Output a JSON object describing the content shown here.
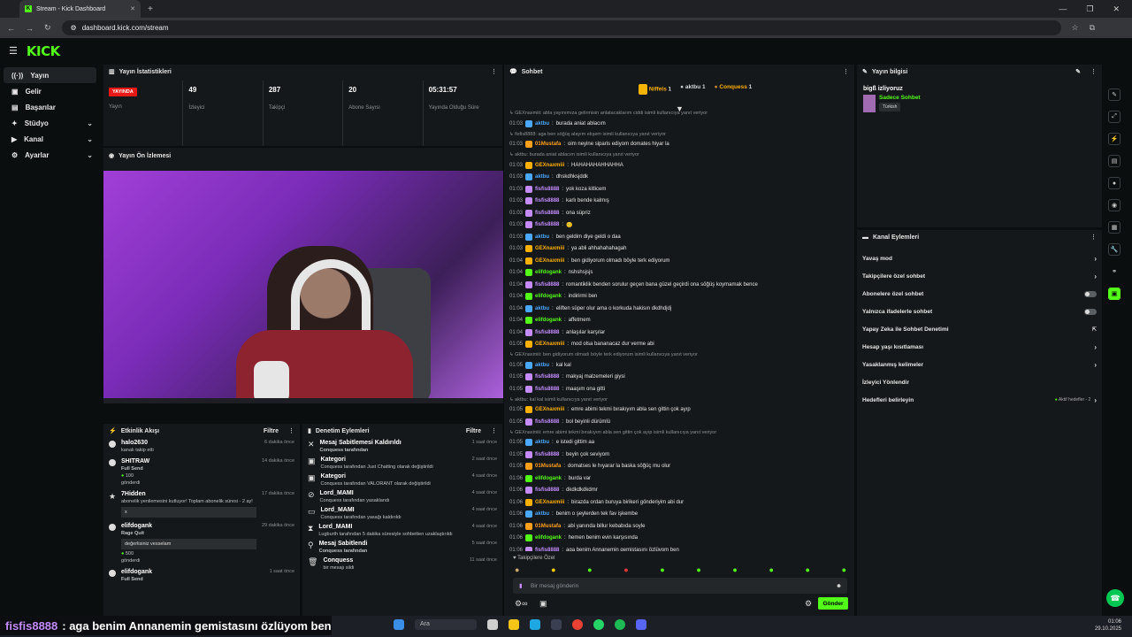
{
  "browser": {
    "tab_title": "Stream - Kick Dashboard",
    "url": "dashboard.kick.com/stream"
  },
  "sidebar": {
    "items": [
      {
        "label": "Yayın"
      },
      {
        "label": "Gelir"
      },
      {
        "label": "Başarılar"
      },
      {
        "label": "Stüdyo"
      },
      {
        "label": "Kanal"
      },
      {
        "label": "Ayarlar"
      }
    ]
  },
  "stats": {
    "title": "Yayın İstatistikleri",
    "live_badge": "YAYINDA",
    "live_label": "Yayın",
    "viewers": "49",
    "viewers_label": "İzleyici",
    "followers": "287",
    "followers_label": "Takipçi",
    "subs": "20",
    "subs_label": "Abone Sayısı",
    "duration": "05:31:57",
    "duration_label": "Yayında Olduğu Süre"
  },
  "preview": {
    "title": "Yayın Ön İzlemesi"
  },
  "activity": {
    "title": "Etkinlik Akışı",
    "filter": "Filtre",
    "events": [
      {
        "name": "halo2630",
        "sub": "kanalı takip etti",
        "time": "6 dakika önce"
      },
      {
        "name": "SHITRAW",
        "sub": "Full Send",
        "extra": "100",
        "extra2": "gönderdi",
        "time": "14 dakika önce"
      },
      {
        "name": "7Hidden",
        "sub": "abonelik yenilemesini kutluyor! Toplam abonelik süresi - 2 ay!",
        "box": "x",
        "time": "17 dakika önce"
      },
      {
        "name": "elifdogank",
        "sub": "Rage Quit",
        "box": "değerlisiniz vesselam",
        "extra": "500",
        "extra2": "gönderdi",
        "time": "29 dakika önce"
      },
      {
        "name": "elifdogank",
        "sub": "Full Send",
        "time": "1 saat önce"
      }
    ]
  },
  "moderation": {
    "title": "Denetim Eylemleri",
    "filter": "Filtre",
    "events": [
      {
        "name": "Mesaj Sabitlemesi Kaldırıldı",
        "sub": "Conquess tarafından",
        "time": "1 saat önce"
      },
      {
        "name": "Kategori",
        "sub": "Conquess tarafından Just Chatting olarak değiştirildi",
        "time": "2 saat önce"
      },
      {
        "name": "Kategori",
        "sub": "Conquess tarafından VALORANT olarak değiştirildi",
        "time": "4 saat önce"
      },
      {
        "name": "Lord_MAMI",
        "sub": "Conquess tarafından yasaklandı",
        "time": "4 saat önce"
      },
      {
        "name": "Lord_MAMI",
        "sub": "Conquess tarafından yasağı kaldırıldı",
        "time": "4 saat önce"
      },
      {
        "name": "Lord_MAMI",
        "sub": "Lugburth tarafından 5 dakika süresiyle sohbetten uzaklaştırıldı",
        "time": "4 saat önce"
      },
      {
        "name": "Mesaj Sabitlendi",
        "sub": "Conquess tarafından",
        "time": "5 saat önce"
      },
      {
        "name": "Conquess",
        "sub": "bir mesajı sildi",
        "time": "11 saat önce"
      }
    ]
  },
  "chat": {
    "title": "Sohbet",
    "top": [
      {
        "name": "Niffels",
        "count": "1"
      },
      {
        "name": "aktbu",
        "count": "1"
      },
      {
        "name": "Conquess",
        "count": "1"
      }
    ],
    "messages": [
      {
        "sys": true,
        "text": "GEXnaxmiii: abla yayınımıza gelirmisin anlatacaklarım ciddi isimli kullanıcıya yanıt veriyor"
      },
      {
        "time": "01:03",
        "user": "aktbu",
        "color": "#4aa8ff",
        "text": "burada aniat ablacım"
      },
      {
        "sys": true,
        "text": "fisfis8888: aga ben söğüş alayım ekşem isimli kullanıcıya yanıt veriyor"
      },
      {
        "time": "01:03",
        "user": "01Mustafa",
        "color": "#ff9f1a",
        "text": "oim neyine siparis ediyom domates hiyar la"
      },
      {
        "sys": true,
        "text": "aktbu: burada aniat ablacım isimli kullanıcıya yanıt veriyor"
      },
      {
        "time": "01:03",
        "user": "GEXnaxmiii",
        "color": "#ffb000",
        "text": "HAHAHAHAHHAHHA"
      },
      {
        "time": "01:03",
        "user": "aktbu",
        "color": "#4aa8ff",
        "text": "dhskdhksjddk"
      },
      {
        "time": "01:03",
        "user": "fisfis8888",
        "color": "#c48cff",
        "text": "yok koza kitlicem"
      },
      {
        "time": "01:03",
        "user": "fisfis8888",
        "color": "#c48cff",
        "text": "karlı bende kalmış"
      },
      {
        "time": "01:03",
        "user": "fisfis8888",
        "color": "#c48cff",
        "text": "ona süpriz"
      },
      {
        "time": "01:03",
        "user": "fisfis8888",
        "color": "#c48cff",
        "text": "🙂"
      },
      {
        "time": "01:03",
        "user": "aktbu",
        "color": "#4aa8ff",
        "text": "ben geldim diye geldi o daa"
      },
      {
        "time": "01:03",
        "user": "GEXnaxmiii",
        "color": "#ffb000",
        "text": "ya abli ahhahahahagah"
      },
      {
        "time": "01:04",
        "user": "GEXnaxmiii",
        "color": "#ffb000",
        "text": "ben gidiyorum olmadı böyle terk ediyorum"
      },
      {
        "time": "01:04",
        "user": "elifdogank",
        "color": "#53fc18",
        "text": "nshshsjsjs"
      },
      {
        "time": "01:04",
        "user": "fisfis8888",
        "color": "#c48cff",
        "text": "romantiklik benden sorulur geçen bana güzel geçirdi ona söğüş koymamak bence"
      },
      {
        "time": "01:04",
        "user": "elifdogank",
        "color": "#53fc18",
        "text": "indirirmi ben"
      },
      {
        "time": "01:04",
        "user": "aktbu",
        "color": "#4aa8ff",
        "text": "eliften süper olur ama o korkuda hakisın dkdhdjdj"
      },
      {
        "time": "01:04",
        "user": "elifdogank",
        "color": "#53fc18",
        "text": "affetmem"
      },
      {
        "time": "01:04",
        "user": "fisfis8888",
        "color": "#c48cff",
        "text": "anlaşılar karşılar"
      },
      {
        "time": "01:05",
        "user": "GEXnaxmiii",
        "color": "#ffb000",
        "text": "mod olsa bananacaz dur verme abi"
      },
      {
        "sys": true,
        "text": "GEXnaxmiii: ben gidiyorum olmadı böyle terk ediyorum isimli kullanıcıya yanıt veriyor"
      },
      {
        "time": "01:05",
        "user": "aktbu",
        "color": "#4aa8ff",
        "text": "kal kal"
      },
      {
        "time": "01:05",
        "user": "fisfis8888",
        "color": "#c48cff",
        "text": "makyaj malzemeleri giysi"
      },
      {
        "time": "01:05",
        "user": "fisfis8888",
        "color": "#c48cff",
        "text": "maaşım ona gitti"
      },
      {
        "sys": true,
        "text": "aktbu: kal kal isimli kullanıcıya yanıt veriyor"
      },
      {
        "time": "01:05",
        "user": "GEXnaxmiii",
        "color": "#ffb000",
        "text": "emre abimi tekmi bırakıyım abla sen gittin çok ayıp"
      },
      {
        "time": "01:05",
        "user": "fisfis8888",
        "color": "#c48cff",
        "text": "bol beyinli dürümlü"
      },
      {
        "sys": true,
        "text": "GEXnaxmiii: emre abimi tekmi bırakıyım abla sen gittin çok ayıp isimli kullanıcıya yanıt veriyor"
      },
      {
        "time": "01:05",
        "user": "aktbu",
        "color": "#4aa8ff",
        "text": "e istedi gittim aa"
      },
      {
        "time": "01:05",
        "user": "fisfis8888",
        "color": "#c48cff",
        "text": "beyin çok seviyom"
      },
      {
        "time": "01:05",
        "user": "01Mustafa",
        "color": "#ff9f1a",
        "text": "domatses le hıyarar la baska söğüç mu olur"
      },
      {
        "time": "01:06",
        "user": "elifdogank",
        "color": "#53fc18",
        "text": "burda var"
      },
      {
        "time": "01:06",
        "user": "fisfis8888",
        "color": "#c48cff",
        "text": "dkdkdkdkdmr"
      },
      {
        "time": "01:06",
        "user": "GEXnaxmiii",
        "color": "#ffb000",
        "text": "birazda ordan buruya birikeri gönderiyim abi dur"
      },
      {
        "time": "01:06",
        "user": "aktbu",
        "color": "#4aa8ff",
        "text": "benim o şeylerden tek fav işkembe"
      },
      {
        "time": "01:06",
        "user": "01Mustafa",
        "color": "#ff9f1a",
        "text": "abi yanında billur kebabıda soyle"
      },
      {
        "time": "01:06",
        "user": "elifdogank",
        "color": "#53fc18",
        "text": "hemen benim evin karşısında"
      },
      {
        "time": "01:06",
        "user": "fisfis8888",
        "color": "#c48cff",
        "text": "aga benim Annanemin gemistasını özlüyom ben"
      }
    ],
    "followers_only": "Takipçilere Özel",
    "input_placeholder": "Bir mesaj gönderin",
    "send_label": "Gönder"
  },
  "stream_info": {
    "title": "Yayın bilgisi",
    "stream_title": "bigß izliyoruz",
    "category": "Sadece Sohbet",
    "language": "Türkish"
  },
  "channel_actions": {
    "title": "Kanal Eylemleri",
    "items": [
      {
        "label": "Yavaş mod",
        "ctrl": "chevron"
      },
      {
        "label": "Takipçilere özel sohbet",
        "ctrl": "chevron"
      },
      {
        "label": "Abonelere özel sohbet",
        "ctrl": "toggle"
      },
      {
        "label": "Yalnızca ifadelerle sohbet",
        "ctrl": "toggle"
      },
      {
        "label": "Yapay Zeka ile Sohbet Denetimi",
        "ctrl": "ext"
      },
      {
        "label": "Hesap yaşı kısıtlaması",
        "ctrl": "chevron"
      },
      {
        "label": "Yasaklanmış kelimeler",
        "ctrl": "chevron"
      },
      {
        "label": "İzleyici Yönlendir",
        "ctrl": "none"
      },
      {
        "label": "Hedefleri belirleyin",
        "ctrl": "chevron",
        "note": "Aktif hedefler - 2"
      }
    ]
  },
  "caption": {
    "user": "fisfis8888",
    "text": ": aga benim Annanemin gemistasını özlüyom ben"
  },
  "taskbar": {
    "search": "Ara",
    "time": "01:06",
    "date": "29.10.2025"
  }
}
